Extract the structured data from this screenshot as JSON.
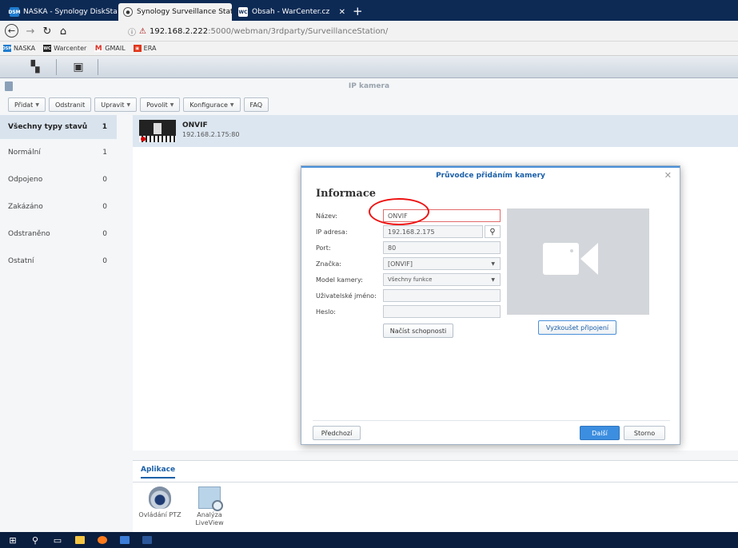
{
  "browser": {
    "tabs": [
      {
        "title": "NASKA - Synology DiskStation",
        "favicon": "DSM"
      },
      {
        "title": "Synology Surveillance Station -",
        "favicon": "ss"
      },
      {
        "title": "Obsah - WarCenter.cz",
        "favicon": "WC"
      }
    ],
    "url_host": "192.168.2.222",
    "url_path": ":5000/webman/3rdparty/SurveillanceStation/",
    "bookmarks": [
      "NASKA",
      "Warcenter",
      "GMAIL",
      "ERA"
    ]
  },
  "app": {
    "title": "IP kamera",
    "toolbar": [
      "Přidat",
      "Odstranit",
      "Upravit",
      "Povolit",
      "Konfigurace",
      "FAQ"
    ],
    "sidebar": [
      {
        "label": "Všechny typy stavů",
        "count": "1"
      },
      {
        "label": "Normální",
        "count": "1"
      },
      {
        "label": "Odpojeno",
        "count": "0"
      },
      {
        "label": "Zakázáno",
        "count": "0"
      },
      {
        "label": "Odstraněno",
        "count": "0"
      },
      {
        "label": "Ostatní",
        "count": "0"
      }
    ],
    "camera": {
      "name": "ONVIF",
      "address": "192.168.2.175:80"
    },
    "apps_tab": "Aplikace",
    "apps": [
      "Ovládání PTZ",
      "Analýza LiveView"
    ]
  },
  "dialog": {
    "title": "Průvodce přidáním kamery",
    "heading": "Informace",
    "fields": {
      "name_label": "Název:",
      "name_value": "ONVIF",
      "ip_label": "IP adresa:",
      "ip_value": "192.168.2.175",
      "port_label": "Port:",
      "port_value": "80",
      "brand_label": "Značka:",
      "brand_value": "[ONVIF]",
      "model_label": "Model kamery:",
      "model_value": "Všechny funkce",
      "user_label": "Uživatelské jméno:",
      "user_value": "",
      "pass_label": "Heslo:",
      "pass_value": ""
    },
    "load_caps": "Načíst schopnosti",
    "test_conn": "Vyzkoušet připojení",
    "prev": "Předchozí",
    "next": "Další",
    "cancel": "Storno"
  }
}
